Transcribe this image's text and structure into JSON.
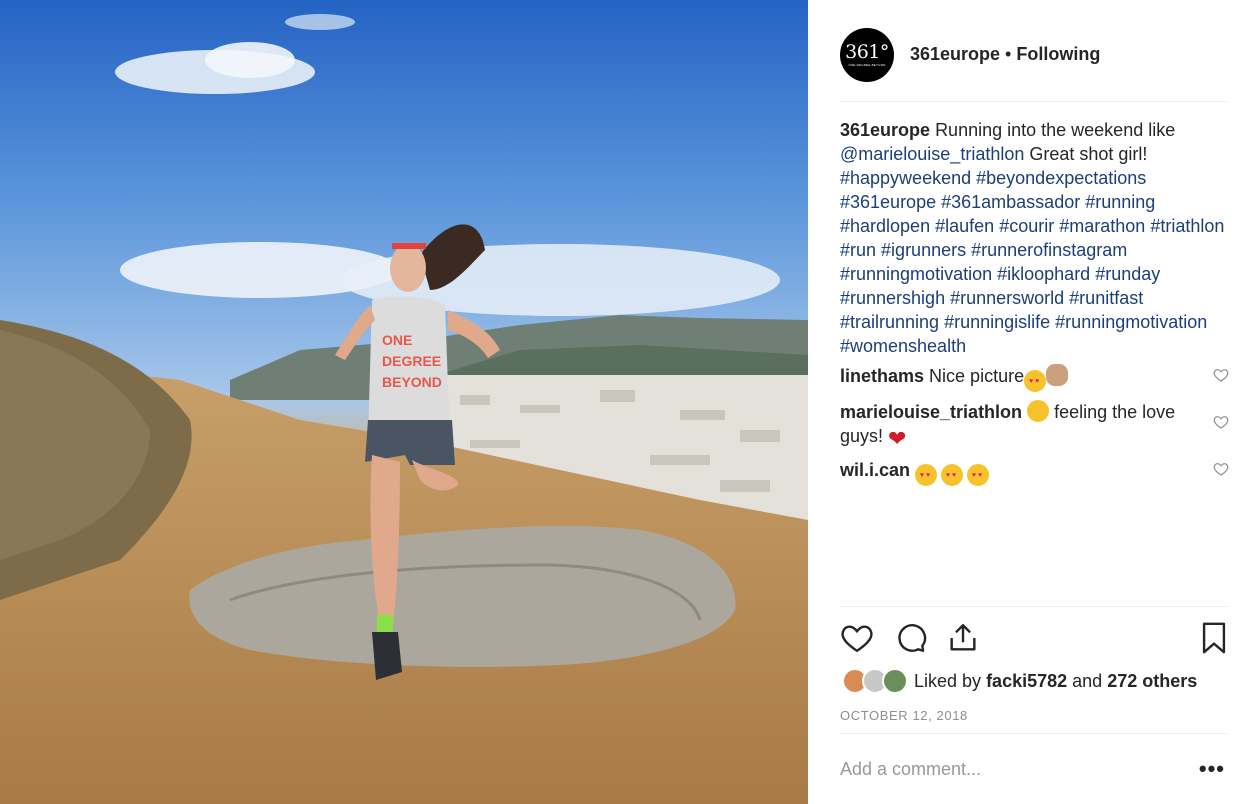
{
  "photo": {
    "alt_name": "post-photo",
    "shirt_text": [
      "ONE",
      "DEGREE",
      "BEYOND"
    ]
  },
  "header": {
    "avatar_logo": "361°",
    "avatar_sub": "ONE DEGREE BEYOND",
    "username": "361europe",
    "separator": "•",
    "follow_status": "Following"
  },
  "caption": {
    "username": "361europe",
    "text_1": "Running into the weekend like",
    "mention": "@marielouise_triathlon",
    "text_2": "Great shot girl!",
    "hashtags": [
      "#happyweekend",
      "#beyondexpectations",
      "#361europe",
      "#361ambassador",
      "#running",
      "#hardlopen",
      "#laufen",
      "#courir",
      "#marathon",
      "#triathlon",
      "#run",
      "#igrunners",
      "#runnerofinstagram",
      "#runningmotivation",
      "#ikloophard",
      "#runday",
      "#runnershigh",
      "#runnersworld",
      "#runitfast",
      "#trailrunning",
      "#runningislife",
      "#runningmotivation",
      "#womenshealth"
    ]
  },
  "comments": [
    {
      "username": "linethams",
      "text": "Nice picture",
      "emojis": [
        "heart-eyes-emoji",
        "clapping-hands-emoji"
      ]
    },
    {
      "username": "marielouise_triathlon",
      "text_before": "",
      "text": "feeling the love guys!",
      "emojis": [
        "hugging-face-emoji",
        "red-heart-emoji"
      ]
    },
    {
      "username": "wil.i.can",
      "text": "",
      "emojis": [
        "heart-eyes-emoji",
        "heart-eyes-emoji",
        "heart-eyes-emoji"
      ]
    }
  ],
  "icons": {
    "like": "heart-outline-icon",
    "comment": "speech-bubble-icon",
    "share": "share-upload-icon",
    "save": "bookmark-icon",
    "comment_like": "heart-outline-icon"
  },
  "likes": {
    "prefix": "Liked by",
    "user": "facki5782",
    "connector": "and",
    "others": "272 others"
  },
  "date": "OCTOBER 12, 2018",
  "comment_input": {
    "placeholder": "Add a comment..."
  },
  "more_options": "•••",
  "colors": {
    "link": "#1c3f7a",
    "text": "#262626",
    "muted": "#8e8e8e",
    "border": "#efefef"
  }
}
